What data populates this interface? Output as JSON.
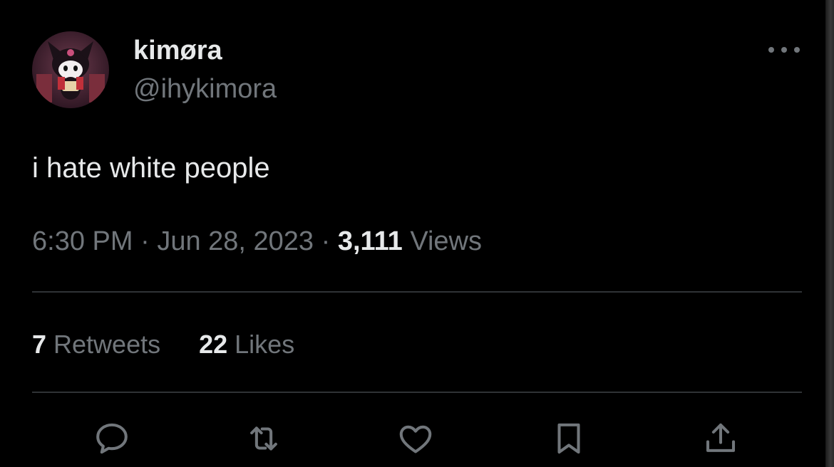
{
  "tweet": {
    "display_name": "kimøra",
    "handle": "@ihykimora",
    "text": "i hate white people",
    "time": "6:30 PM",
    "separator": " · ",
    "date": "Jun 28, 2023",
    "views_count": "3,111",
    "views_label": "Views"
  },
  "stats": {
    "retweets_count": "7",
    "retweets_label": "Retweets",
    "likes_count": "22",
    "likes_label": "Likes"
  },
  "icons": {
    "more": "more-horizontal-icon",
    "reply": "reply-icon",
    "retweet": "retweet-icon",
    "like": "heart-icon",
    "bookmark": "bookmark-icon",
    "share": "share-icon"
  },
  "colors": {
    "background": "#000000",
    "primary_text": "#e7e9ea",
    "secondary_text": "#71767b",
    "divider": "#2f3336"
  }
}
